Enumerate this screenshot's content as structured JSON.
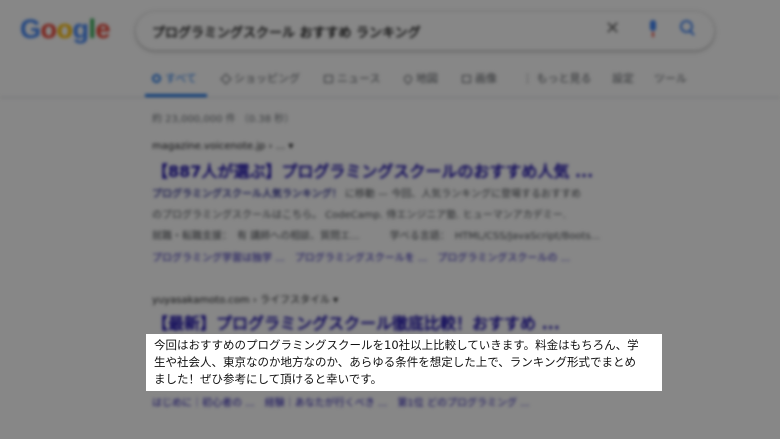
{
  "logo": {
    "text": "Google"
  },
  "search": {
    "query": "プログラミングスクール おすすめ ランキング"
  },
  "tabs": [
    {
      "label": "すべて",
      "active": true
    },
    {
      "label": "ショッピング"
    },
    {
      "label": "ニュース"
    },
    {
      "label": "地図"
    },
    {
      "label": "画像"
    },
    {
      "label": "もっと見る"
    },
    {
      "label": "設定"
    },
    {
      "label": "ツール"
    }
  ],
  "results_count": "約 23,000,000 件 （0.38 秒）",
  "results": [
    {
      "url": "magazine.voicenote.jp › ... ▾",
      "title": "【887人が選ぶ】プログラミングスクールのおすすめ人気 ...",
      "snippet_bold": "プログラミングスクール人気ランキング！",
      "snippet_rest": " に移動 — 今回、人気ランキングに登場するおすすめ",
      "snippet_line2": "のプログラミングスクールはこちら。 CodeCamp. 侍エンジニア塾. ヒューマンアカデミー.",
      "snippet_line3": "就職・転職支援：　有 講師への相談、質問エ...　　　学べる言語：　HTML/CSS/JavaScript/Boots...",
      "links": "プログラミング学習は独学 ...　プログラミングスクールを ...　プログラミングスクールの ..."
    },
    {
      "url": "yuyasakamoto.com › ライフスタイル ▾",
      "title": "【最新】プログラミングスクール徹底比較！おすすめ ...",
      "links": "はじめに｜初心者の ...　経験｜あなたが行くべき ...　第1位 どのプログラミング ..."
    }
  ],
  "highlight": {
    "line1": "今回はおすすめのプログラミングスクールを10社以上比較していきます。料金はもちろん、学",
    "line2": "生や社会人、東京なのか地方なのか、あらゆる条件を想定した上で、ランキング形式でまとめ",
    "line3": "ました！ぜひ参考にして頂けると幸いです。"
  }
}
